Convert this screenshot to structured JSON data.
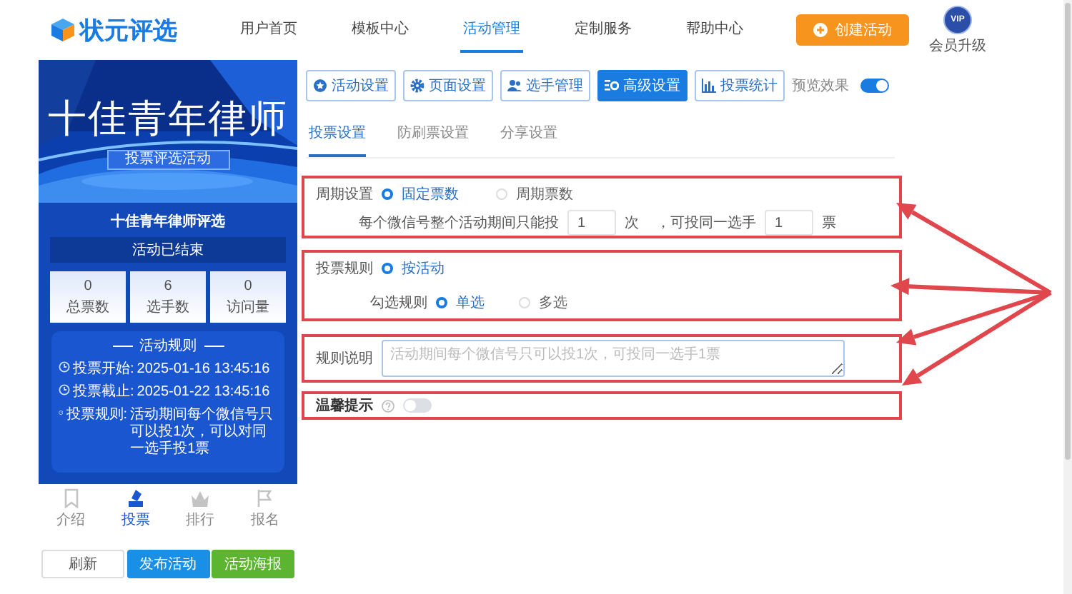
{
  "nav": {
    "logo": "状元评选",
    "items": [
      {
        "label": "用户首页",
        "selected": false
      },
      {
        "label": "模板中心",
        "selected": false
      },
      {
        "label": "活动管理",
        "selected": true
      },
      {
        "label": "定制服务",
        "selected": false
      },
      {
        "label": "帮助中心",
        "selected": false
      }
    ],
    "create_button": "创建活动",
    "vip_badge": "VIP",
    "vip_label": "会员升级"
  },
  "preview": {
    "banner_title": "十佳青年律师",
    "banner_subtitle": "投票评选活动",
    "activity_name": "十佳青年律师评选",
    "status": "活动已结束",
    "stats": [
      {
        "value": "0",
        "label": "总票数"
      },
      {
        "value": "6",
        "label": "选手数"
      },
      {
        "value": "0",
        "label": "访问量"
      }
    ],
    "rules_title": "活动规则",
    "rules": [
      {
        "label": "投票开始:",
        "value": "2025-01-16 13:45:16"
      },
      {
        "label": "投票截止:",
        "value": "2025-01-22 13:45:16"
      },
      {
        "label": "投票规则:",
        "value": "活动期间每个微信号只可以投1次，可以对同一选手投1票"
      }
    ],
    "tabs": [
      {
        "label": "介绍",
        "selected": false,
        "kind": "bookmark"
      },
      {
        "label": "投票",
        "selected": true,
        "kind": "vote"
      },
      {
        "label": "排行",
        "selected": false,
        "kind": "crown"
      },
      {
        "label": "报名",
        "selected": false,
        "kind": "flag"
      }
    ]
  },
  "actions": [
    {
      "label": "刷新",
      "kind": "outline"
    },
    {
      "label": "发布活动",
      "kind": "primary"
    },
    {
      "label": "活动海报",
      "kind": "success"
    }
  ],
  "toolbar": {
    "buttons": [
      {
        "label": "活动设置",
        "selected": false,
        "kind": "star"
      },
      {
        "label": "页面设置",
        "selected": false,
        "kind": "gear"
      },
      {
        "label": "选手管理",
        "selected": false,
        "kind": "people"
      },
      {
        "label": "高级设置",
        "selected": true,
        "kind": "gears"
      },
      {
        "label": "投票统计",
        "selected": false,
        "kind": "chart"
      }
    ],
    "preview_toggle": {
      "label": "预览效果",
      "on": true
    }
  },
  "subtabs": [
    {
      "label": "投票设置",
      "selected": true
    },
    {
      "label": "防刷票设置",
      "selected": false
    },
    {
      "label": "分享设置",
      "selected": false
    }
  ],
  "sections": [
    {
      "kind": "period",
      "highlighted": true,
      "label": "周期设置",
      "options": [
        {
          "label": "固定票数",
          "selected": true
        },
        {
          "label": "周期票数",
          "selected": false
        }
      ],
      "sentence": {
        "before": "每个微信号整个活动期间只能投",
        "times": "1",
        "times_unit": "次",
        "middle": "，可投同一选手",
        "votes": "1",
        "votes_unit": "票"
      }
    },
    {
      "kind": "rule",
      "highlighted": true,
      "label": "投票规则",
      "options": [
        {
          "label": "按活动",
          "selected": true
        }
      ],
      "check_rule": {
        "label": "勾选规则",
        "options": [
          {
            "label": "单选",
            "selected": true
          },
          {
            "label": "多选",
            "selected": false
          }
        ]
      }
    },
    {
      "kind": "description",
      "highlighted": true,
      "label": "规则说明",
      "placeholder": "活动期间每个微信号只可以投1次，可投同一选手1票"
    },
    {
      "kind": "tips",
      "highlighted": true,
      "label": "温馨提示",
      "on": false
    }
  ]
}
